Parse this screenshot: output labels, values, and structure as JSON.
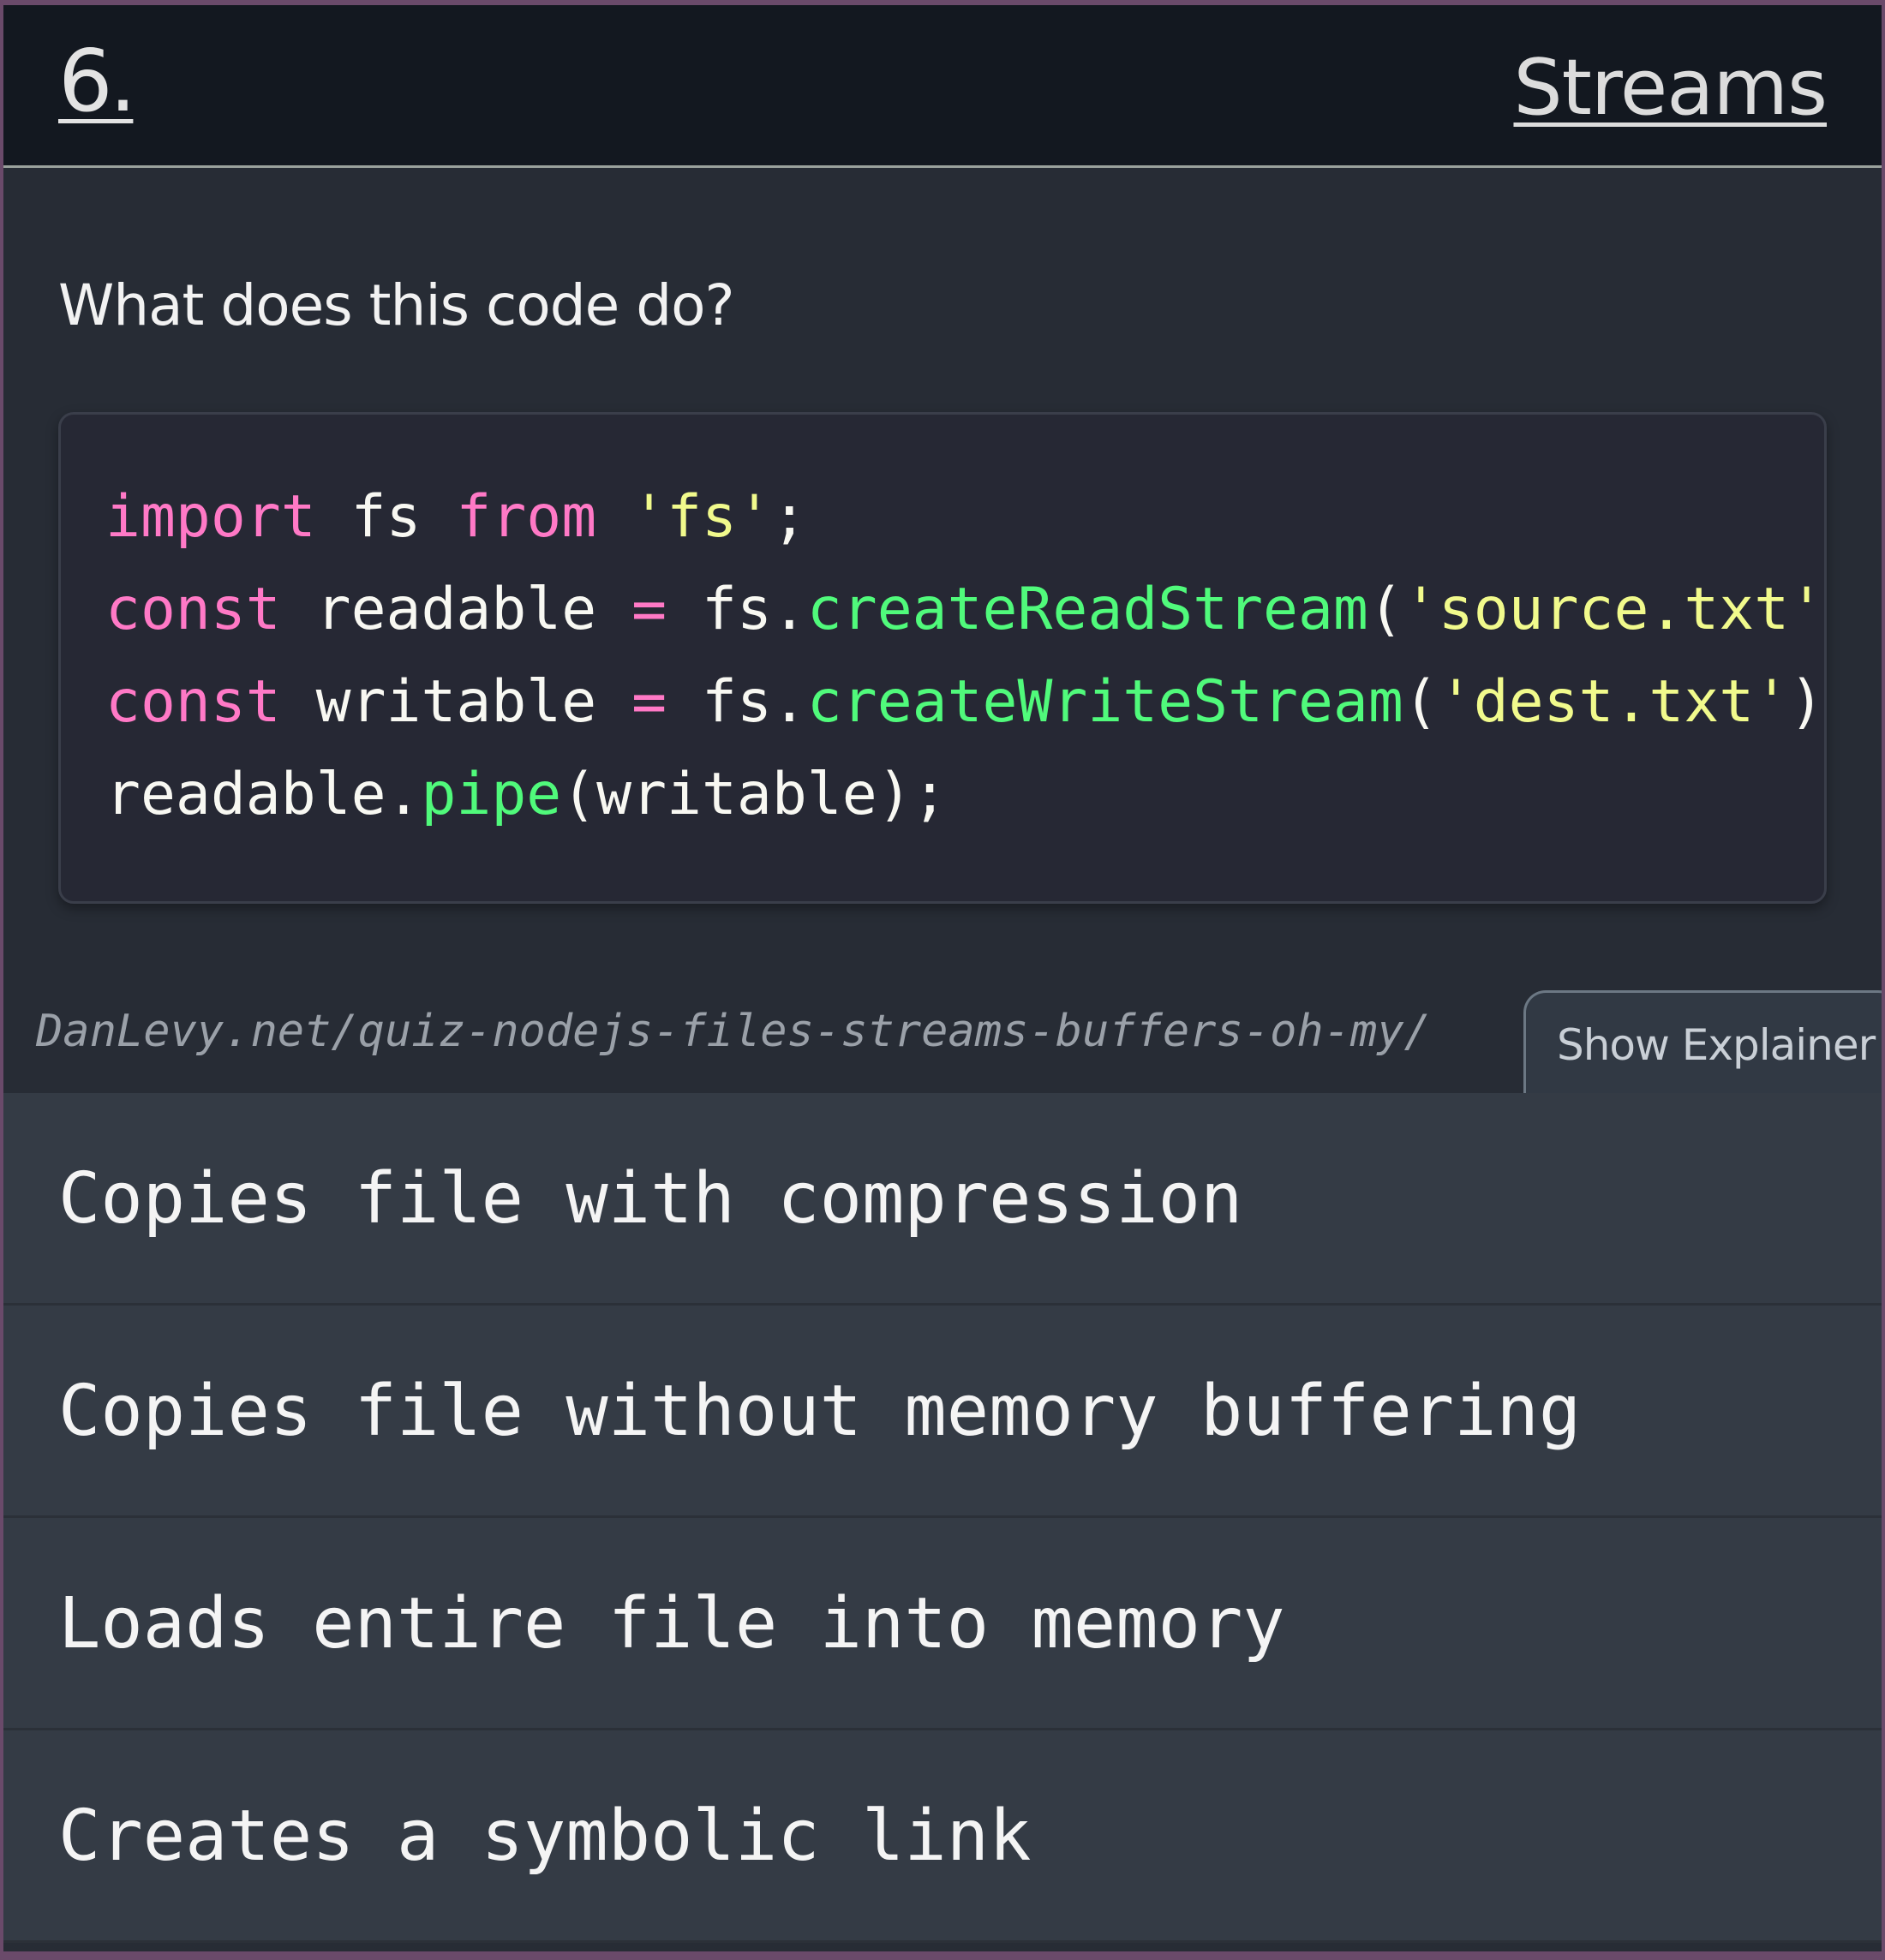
{
  "header": {
    "number": "6.",
    "topic": "Streams"
  },
  "question": "What does this code do?",
  "code": {
    "line1": {
      "kw1": "import",
      "t1": " fs ",
      "kw2": "from",
      "t2": " ",
      "str": "'fs'",
      "t3": ";"
    },
    "line2": {
      "kw": "const",
      "t1": " readable ",
      "op": "=",
      "t2": " fs.",
      "fn": "createReadStream",
      "t3": "(",
      "str": "'source.txt'",
      "t4": ");"
    },
    "line3": {
      "kw": "const",
      "t1": " writable ",
      "op": "=",
      "t2": " fs.",
      "fn": "createWriteStream",
      "t3": "(",
      "str": "'dest.txt'",
      "t4": ");"
    },
    "line4": {
      "t1": "readable.",
      "fn": "pipe",
      "t2": "(writable);"
    }
  },
  "source_link": "DanLevy.net/quiz-nodejs-files-streams-buffers-oh-my/",
  "explainer_button": "Show Explainer",
  "answers": [
    "Copies file with compression",
    "Copies file without memory buffering",
    "Loads entire file into memory",
    "Creates a symbolic link"
  ]
}
